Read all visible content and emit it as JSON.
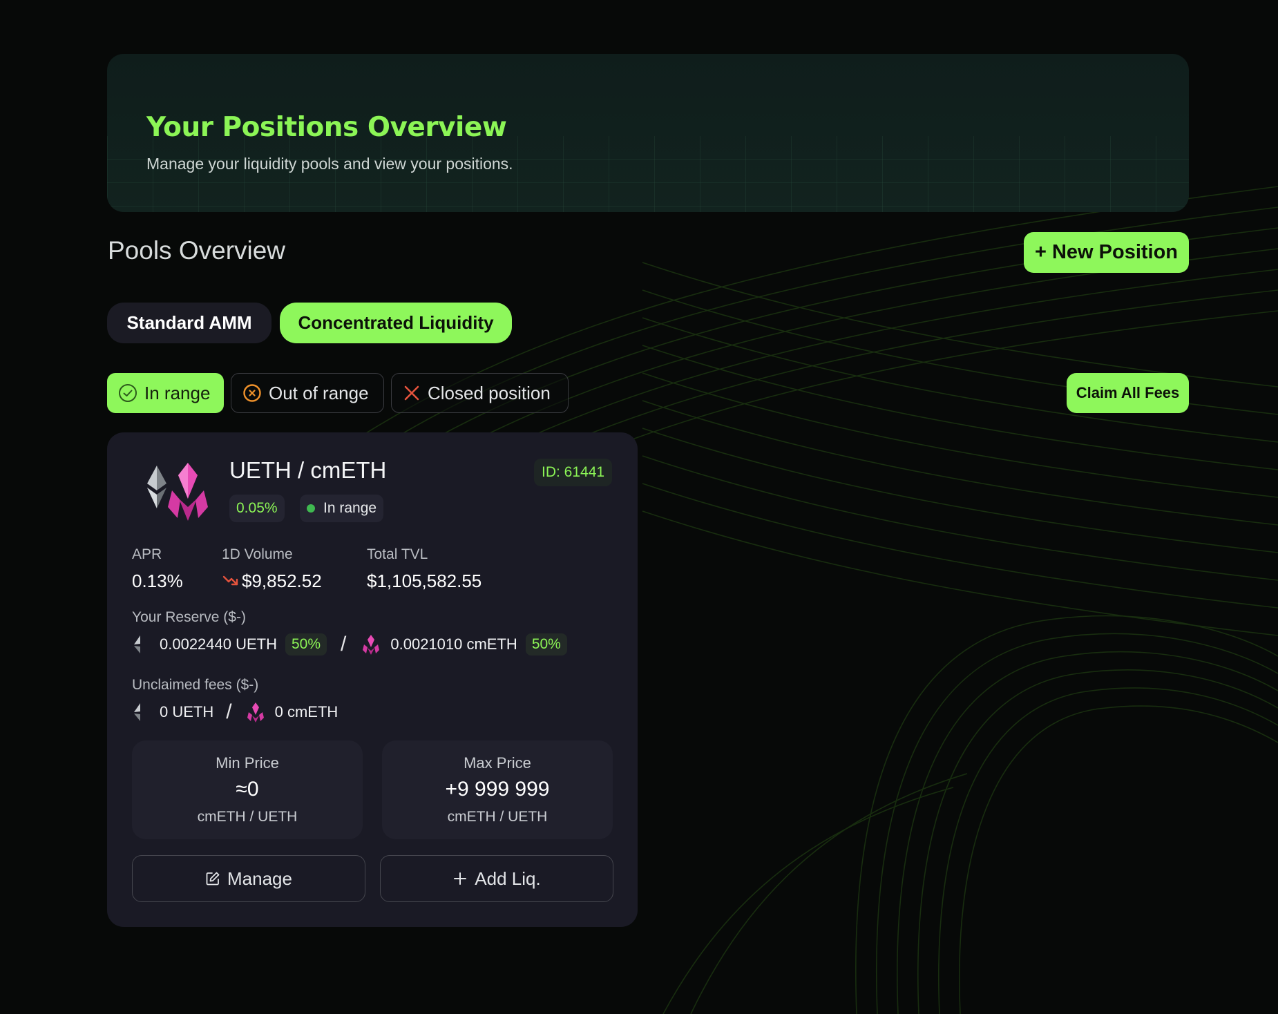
{
  "hero": {
    "title": "Your Positions Overview",
    "subtitle": "Manage your liquidity pools and view your positions."
  },
  "section": {
    "title": "Pools Overview",
    "new_position_label": "+ New Position"
  },
  "tabs": [
    {
      "label": "Standard AMM",
      "active": false
    },
    {
      "label": "Concentrated Liquidity",
      "active": true
    }
  ],
  "filters": [
    {
      "label": "In range",
      "icon": "check-circle-icon",
      "active": true
    },
    {
      "label": "Out of range",
      "icon": "x-circle-icon",
      "active": false
    },
    {
      "label": "Closed position",
      "icon": "x-icon",
      "active": false
    }
  ],
  "claim_all_label": "Claim All Fees",
  "position": {
    "pair": "UETH / cmETH",
    "id": "ID: 61441",
    "fee_tier": "0.05%",
    "status": "In range",
    "stats": {
      "apr_label": "APR",
      "apr_value": "0.13%",
      "volume_label": "1D Volume",
      "volume_value": "$9,852.52",
      "tvl_label": "Total TVL",
      "tvl_value": "$1,105,582.55"
    },
    "reserve": {
      "label": "Your Reserve  ($-)",
      "token_a": "0.0022440 UETH",
      "token_a_pct": "50%",
      "token_b": "0.0021010 cmETH",
      "token_b_pct": "50%"
    },
    "fees": {
      "label": "Unclaimed fees  ($-)",
      "token_a": "0 UETH",
      "token_b": "0 cmETH"
    },
    "min_price": {
      "title": "Min Price",
      "value": "≈0",
      "unit": "cmETH / UETH"
    },
    "max_price": {
      "title": "Max Price",
      "value": "+9 999 999",
      "unit": "cmETH / UETH"
    },
    "manage_label": "Manage",
    "add_label": "Add Liq.",
    "separator": "/"
  },
  "colors": {
    "accent": "#8ef75b",
    "background": "#070908",
    "card": "#1a1a25",
    "in_range_dot": "#3fb950",
    "out_of_range": "#f0922b",
    "closed": "#e5533d"
  }
}
